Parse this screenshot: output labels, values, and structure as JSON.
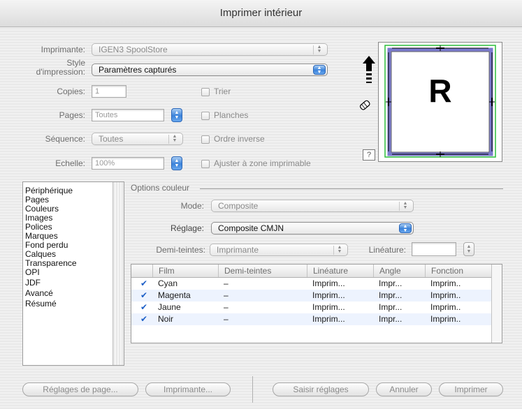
{
  "window": {
    "title": "Imprimer intérieur"
  },
  "printer": {
    "label": "Imprimante:",
    "value": "IGEN3 SpoolStore"
  },
  "print_style": {
    "label_line1": "Style",
    "label_line2": "d'impression:",
    "value": "Paramètres capturés"
  },
  "copies": {
    "label": "Copies:",
    "value": "1"
  },
  "pages": {
    "label": "Pages:",
    "value": "Toutes"
  },
  "sequence": {
    "label": "Séquence:",
    "value": "Toutes"
  },
  "scale": {
    "label": "Echelle:",
    "value": "100%"
  },
  "checkboxes": {
    "collate": "Trier",
    "spreads": "Planches",
    "reverse": "Ordre inverse",
    "fit": "Ajuster à zone imprimable"
  },
  "preview": {
    "letter": "R",
    "help": "?"
  },
  "sidebar": {
    "items": [
      "Périphérique",
      "Pages",
      "Couleurs",
      "Images",
      "Polices",
      "Marques",
      "Fond perdu",
      "Calques",
      "Transparence",
      "OPI",
      "JDF",
      "Avancé",
      "Résumé"
    ]
  },
  "color_options": {
    "group_title": "Options couleur",
    "mode_label": "Mode:",
    "mode_value": "Composite",
    "setting_label": "Réglage:",
    "setting_value": "Composite CMJN",
    "halftone_label": "Demi-teintes:",
    "halftone_value": "Imprimante",
    "frequency_label": "Linéature:",
    "frequency_value": ""
  },
  "ink_table": {
    "columns": [
      "Film",
      "Demi-teintes",
      "Linéature",
      "Angle",
      "Fonction"
    ],
    "rows": [
      {
        "check": "✔",
        "film": "Cyan",
        "halftone": "–",
        "frequency": "Imprim...",
        "angle": "Impr...",
        "function": "Imprim.."
      },
      {
        "check": "✔",
        "film": "Magenta",
        "halftone": "–",
        "frequency": "Imprim...",
        "angle": "Impr...",
        "function": "Imprim.."
      },
      {
        "check": "✔",
        "film": "Jaune",
        "halftone": "–",
        "frequency": "Imprim...",
        "angle": "Impr...",
        "function": "Imprim.."
      },
      {
        "check": "✔",
        "film": "Noir",
        "halftone": "–",
        "frequency": "Imprim...",
        "angle": "Impr...",
        "function": "Imprim.."
      }
    ]
  },
  "buttons": {
    "page_setup": "Réglages de page...",
    "printer": "Imprimante...",
    "save_settings": "Saisir réglages",
    "cancel": "Annuler",
    "print": "Imprimer"
  },
  "colors": {
    "accent": "#3a82da",
    "row_alt": "#edf3fe"
  }
}
